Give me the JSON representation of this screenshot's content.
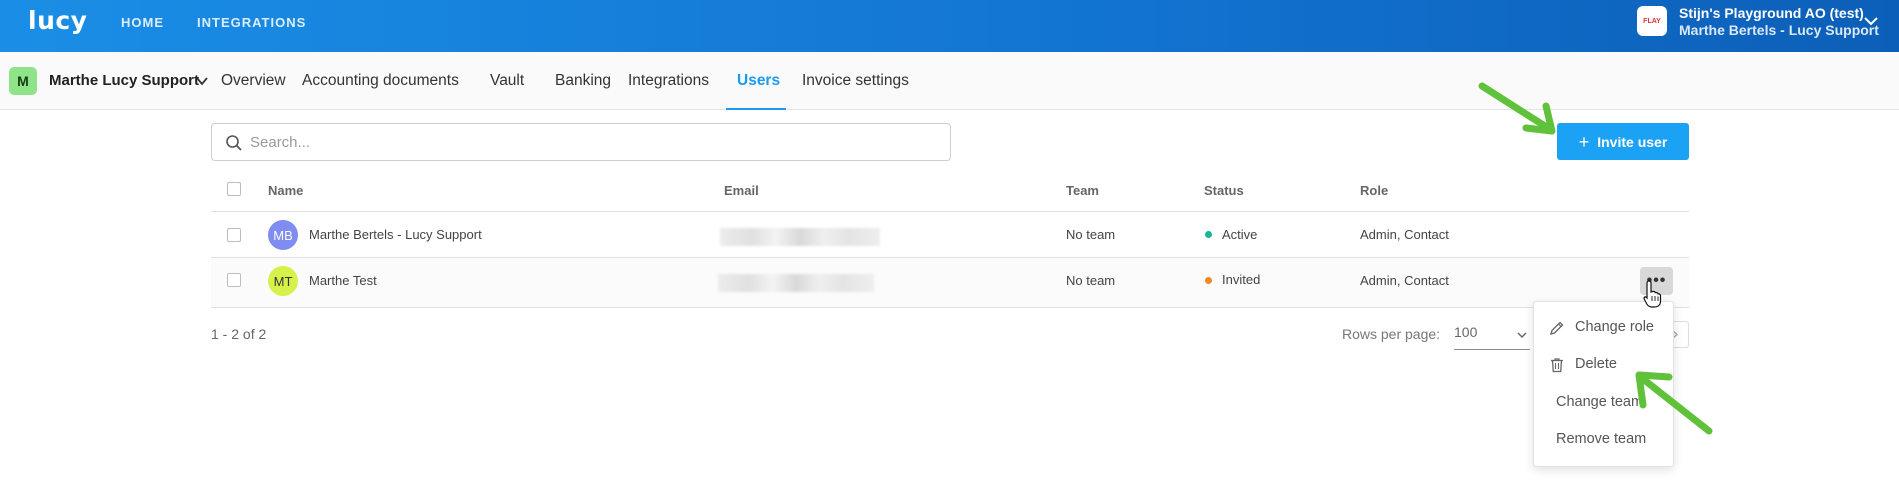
{
  "topbar": {
    "logo": "lucy",
    "nav": [
      "HOME",
      "INTEGRATIONS"
    ],
    "org_logo_text": "FLAY",
    "org_name": "Stijn's Playground AO (test)",
    "org_user": "Marthe Bertels - Lucy Support"
  },
  "company": {
    "avatar": "M",
    "name": "Marthe Lucy Support"
  },
  "tabs": [
    "Overview",
    "Accounting documents",
    "Vault",
    "Banking",
    "Integrations",
    "Users",
    "Invoice settings"
  ],
  "active_tab": "Users",
  "search": {
    "placeholder": "Search..."
  },
  "invite_button": {
    "icon": "+",
    "label": "Invite user"
  },
  "table": {
    "headers": [
      "Name",
      "Email",
      "Team",
      "Status",
      "Role"
    ],
    "rows": [
      {
        "initials": "MB",
        "avatar_color": "#7f8cf0",
        "name": "Marthe Bertels - Lucy Support",
        "team": "No team",
        "status": "Active",
        "status_color": "#15b79a",
        "role": "Admin, Contact"
      },
      {
        "initials": "MT",
        "avatar_color": "#d6f24a",
        "name": "Marthe Test",
        "team": "No team",
        "status": "Invited",
        "status_color": "#f5891f",
        "role": "Admin, Contact"
      }
    ]
  },
  "pagination": {
    "range": "1 - 2 of 2",
    "rows_per_page_label": "Rows per page:",
    "rows_per_page_value": "100"
  },
  "context_menu": {
    "items": [
      "Change role",
      "Delete",
      "Change team",
      "Remove team"
    ]
  },
  "colors": {
    "primary": "#1ca2f5",
    "annotation_arrow": "#5fc23a"
  }
}
